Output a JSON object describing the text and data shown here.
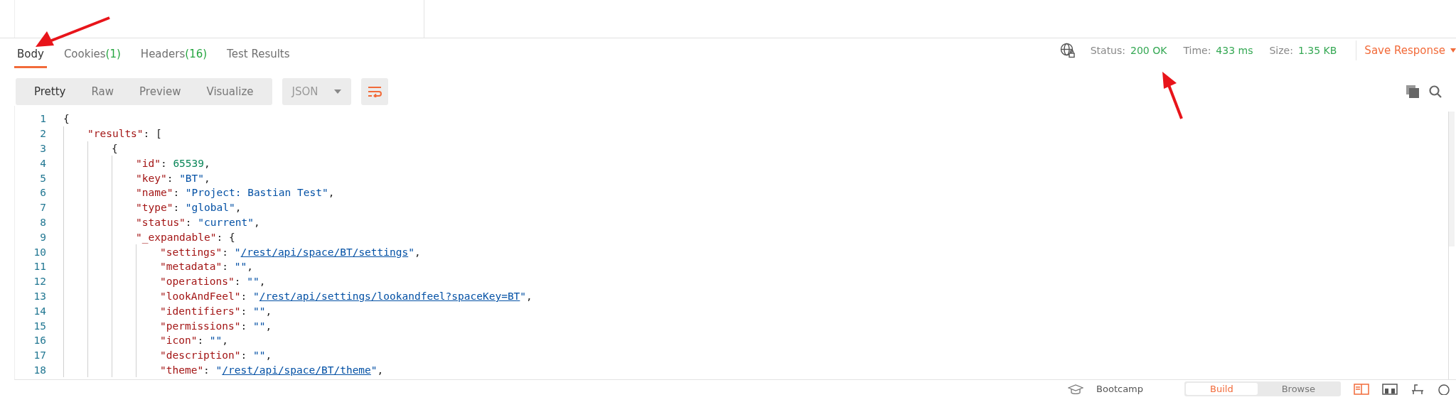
{
  "response_tabs": [
    {
      "label": "Body",
      "selected": true
    },
    {
      "label": "Cookies",
      "count": "(1)",
      "selected": false
    },
    {
      "label": "Headers",
      "count": "(16)",
      "selected": false
    },
    {
      "label": "Test Results",
      "selected": false
    }
  ],
  "status": [
    {
      "label": "Status:",
      "value": "200 OK"
    },
    {
      "label": "Time:",
      "value": "433 ms"
    },
    {
      "label": "Size:",
      "value": "1.35 KB"
    }
  ],
  "save_response": "Save Response",
  "view_modes": [
    {
      "label": "Pretty",
      "selected": true
    },
    {
      "label": "Raw",
      "selected": false
    },
    {
      "label": "Preview",
      "selected": false
    },
    {
      "label": "Visualize",
      "selected": false
    }
  ],
  "format": "JSON",
  "code_lines": [
    {
      "n": "1",
      "tokens": [
        {
          "text": "{",
          "kind": "punc"
        }
      ],
      "children": [
        {
          "n": "2",
          "tokens": [
            {
              "text": "\"results\"",
              "kind": "key"
            },
            {
              "text": ": [",
              "kind": "punc"
            }
          ],
          "children": [
            {
              "n": "3",
              "tokens": [
                {
                  "text": "{",
                  "kind": "punc"
                }
              ],
              "children": [
                {
                  "n": "4",
                  "tokens": [
                    {
                      "text": "\"id\"",
                      "kind": "key"
                    },
                    {
                      "text": ": ",
                      "kind": "punc"
                    },
                    {
                      "text": "65539",
                      "kind": "num"
                    },
                    {
                      "text": ",",
                      "kind": "punc"
                    }
                  ]
                },
                {
                  "n": "5",
                  "tokens": [
                    {
                      "text": "\"key\"",
                      "kind": "key"
                    },
                    {
                      "text": ": ",
                      "kind": "punc"
                    },
                    {
                      "text": "\"BT\"",
                      "kind": "str"
                    },
                    {
                      "text": ",",
                      "kind": "punc"
                    }
                  ]
                },
                {
                  "n": "6",
                  "tokens": [
                    {
                      "text": "\"name\"",
                      "kind": "key"
                    },
                    {
                      "text": ": ",
                      "kind": "punc"
                    },
                    {
                      "text": "\"Project: Bastian Test\"",
                      "kind": "str"
                    },
                    {
                      "text": ",",
                      "kind": "punc"
                    }
                  ]
                },
                {
                  "n": "7",
                  "tokens": [
                    {
                      "text": "\"type\"",
                      "kind": "key"
                    },
                    {
                      "text": ": ",
                      "kind": "punc"
                    },
                    {
                      "text": "\"global\"",
                      "kind": "str"
                    },
                    {
                      "text": ",",
                      "kind": "punc"
                    }
                  ]
                },
                {
                  "n": "8",
                  "tokens": [
                    {
                      "text": "\"status\"",
                      "kind": "key"
                    },
                    {
                      "text": ": ",
                      "kind": "punc"
                    },
                    {
                      "text": "\"current\"",
                      "kind": "str"
                    },
                    {
                      "text": ",",
                      "kind": "punc"
                    }
                  ]
                },
                {
                  "n": "9",
                  "tokens": [
                    {
                      "text": "\"_expandable\"",
                      "kind": "key"
                    },
                    {
                      "text": ": {",
                      "kind": "punc"
                    }
                  ],
                  "children": [
                    {
                      "n": "10",
                      "tokens": [
                        {
                          "text": "\"settings\"",
                          "kind": "key"
                        },
                        {
                          "text": ": ",
                          "kind": "punc"
                        },
                        {
                          "text": "\"",
                          "kind": "str"
                        },
                        {
                          "text": "/rest/api/space/BT/settings",
                          "kind": "link"
                        },
                        {
                          "text": "\"",
                          "kind": "str"
                        },
                        {
                          "text": ",",
                          "kind": "punc"
                        }
                      ]
                    },
                    {
                      "n": "11",
                      "tokens": [
                        {
                          "text": "\"metadata\"",
                          "kind": "key"
                        },
                        {
                          "text": ": ",
                          "kind": "punc"
                        },
                        {
                          "text": "\"\"",
                          "kind": "str"
                        },
                        {
                          "text": ",",
                          "kind": "punc"
                        }
                      ]
                    },
                    {
                      "n": "12",
                      "tokens": [
                        {
                          "text": "\"operations\"",
                          "kind": "key"
                        },
                        {
                          "text": ": ",
                          "kind": "punc"
                        },
                        {
                          "text": "\"\"",
                          "kind": "str"
                        },
                        {
                          "text": ",",
                          "kind": "punc"
                        }
                      ]
                    },
                    {
                      "n": "13",
                      "tokens": [
                        {
                          "text": "\"lookAndFeel\"",
                          "kind": "key"
                        },
                        {
                          "text": ": ",
                          "kind": "punc"
                        },
                        {
                          "text": "\"",
                          "kind": "str"
                        },
                        {
                          "text": "/rest/api/settings/lookandfeel?spaceKey=BT",
                          "kind": "link"
                        },
                        {
                          "text": "\"",
                          "kind": "str"
                        },
                        {
                          "text": ",",
                          "kind": "punc"
                        }
                      ]
                    },
                    {
                      "n": "14",
                      "tokens": [
                        {
                          "text": "\"identifiers\"",
                          "kind": "key"
                        },
                        {
                          "text": ": ",
                          "kind": "punc"
                        },
                        {
                          "text": "\"\"",
                          "kind": "str"
                        },
                        {
                          "text": ",",
                          "kind": "punc"
                        }
                      ]
                    },
                    {
                      "n": "15",
                      "tokens": [
                        {
                          "text": "\"permissions\"",
                          "kind": "key"
                        },
                        {
                          "text": ": ",
                          "kind": "punc"
                        },
                        {
                          "text": "\"\"",
                          "kind": "str"
                        },
                        {
                          "text": ",",
                          "kind": "punc"
                        }
                      ]
                    },
                    {
                      "n": "16",
                      "tokens": [
                        {
                          "text": "\"icon\"",
                          "kind": "key"
                        },
                        {
                          "text": ": ",
                          "kind": "punc"
                        },
                        {
                          "text": "\"\"",
                          "kind": "str"
                        },
                        {
                          "text": ",",
                          "kind": "punc"
                        }
                      ]
                    },
                    {
                      "n": "17",
                      "tokens": [
                        {
                          "text": "\"description\"",
                          "kind": "key"
                        },
                        {
                          "text": ": ",
                          "kind": "punc"
                        },
                        {
                          "text": "\"\"",
                          "kind": "str"
                        },
                        {
                          "text": ",",
                          "kind": "punc"
                        }
                      ]
                    },
                    {
                      "n": "18",
                      "tokens": [
                        {
                          "text": "\"theme\"",
                          "kind": "key"
                        },
                        {
                          "text": ": ",
                          "kind": "punc"
                        },
                        {
                          "text": "\"",
                          "kind": "str"
                        },
                        {
                          "text": "/rest/api/space/BT/theme",
                          "kind": "link"
                        },
                        {
                          "text": "\"",
                          "kind": "str"
                        },
                        {
                          "text": ",",
                          "kind": "punc"
                        }
                      ]
                    }
                  ]
                }
              ]
            }
          ]
        }
      ]
    }
  ],
  "footer": {
    "bootcamp": "Bootcamp",
    "modes": [
      {
        "label": "Build",
        "selected": true
      },
      {
        "label": "Browse",
        "selected": false
      }
    ]
  }
}
